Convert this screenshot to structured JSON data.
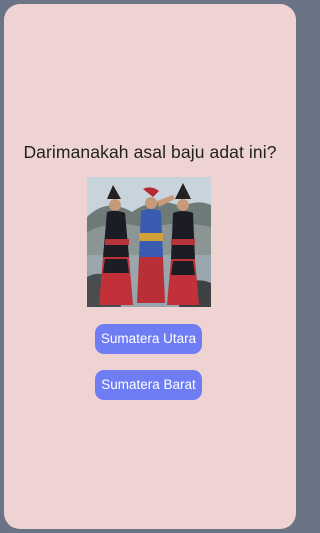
{
  "quiz": {
    "question": "Darimanakah asal baju adat ini?",
    "image_subject": "three-women-in-traditional-batak-costume",
    "options": [
      {
        "label": "Sumatera Utara"
      },
      {
        "label": "Sumatera Barat"
      }
    ]
  },
  "colors": {
    "page_background": "#efd3d3",
    "outer_background": "#6b7386",
    "button_background": "#6f7df5",
    "button_text": "#ffffff",
    "question_text": "#222222"
  }
}
